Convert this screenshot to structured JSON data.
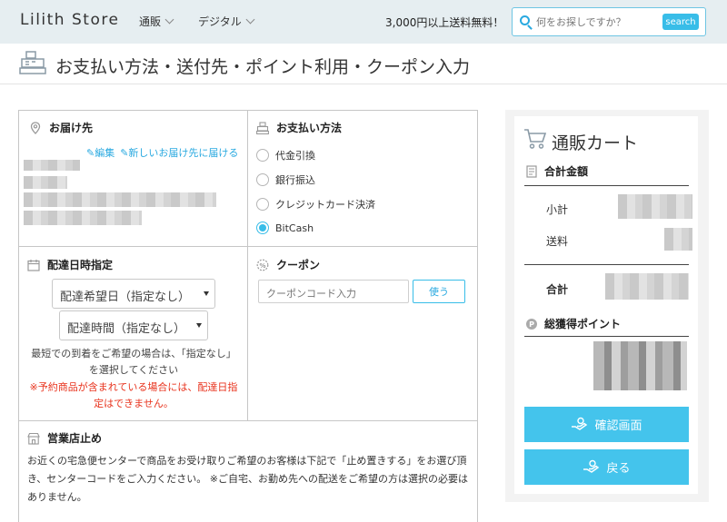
{
  "header": {
    "logo": "Lilith Store",
    "nav": [
      {
        "label": "通販"
      },
      {
        "label": "デジタル"
      }
    ],
    "shipping_note": "3,000円以上送料無料！",
    "search": {
      "placeholder": "何をお探しですか？",
      "button": "search"
    }
  },
  "page_title": "お支払い方法・送付先・ポイント利用・クーポン入力",
  "delivery_address": {
    "heading": "お届け先",
    "edit_link": "✎編集",
    "new_address_link": "✎新しいお届け先に届ける"
  },
  "payment": {
    "heading": "お支払い方法",
    "options": [
      {
        "label": "代金引換",
        "selected": false
      },
      {
        "label": "銀行振込",
        "selected": false
      },
      {
        "label": "クレジットカード決済",
        "selected": false
      },
      {
        "label": "BitCash",
        "selected": true
      }
    ]
  },
  "delivery_date": {
    "heading": "配達日時指定",
    "date_select": "配達希望日（指定なし）",
    "time_select": "配達時間（指定なし）",
    "note_lines": [
      "最短での到着をご希望の場合は、「指定なし」",
      "を選択してください"
    ],
    "warning_lines": [
      "※予約商品が含まれている場合には、配達日指",
      "定はできません。"
    ]
  },
  "coupon": {
    "heading": "クーポン",
    "placeholder": "クーポンコード入力",
    "button": "使う"
  },
  "store_pickup": {
    "heading": "営業店止め",
    "description_lines": [
      "お近くの宅急便センターで商品をお受け取りご希望のお客様は下記で「止め置きする」をお選び頂",
      "き、センターコードをご入力ください。 ※ご自宅、お勤め先への配送をご希望の方は選択の必要は",
      "ありません。"
    ]
  },
  "cart": {
    "title": "通販カート",
    "total_heading": "合計金額",
    "subtotal_label": "小計",
    "shipping_label": "送料",
    "total_label": "合計",
    "points_heading": "総獲得ポイント",
    "confirm_button": "確認画面",
    "back_button": "戻る"
  },
  "colors": {
    "accent": "#38bde8",
    "warning": "#e8321c",
    "header_bg": "#e6eef1"
  }
}
